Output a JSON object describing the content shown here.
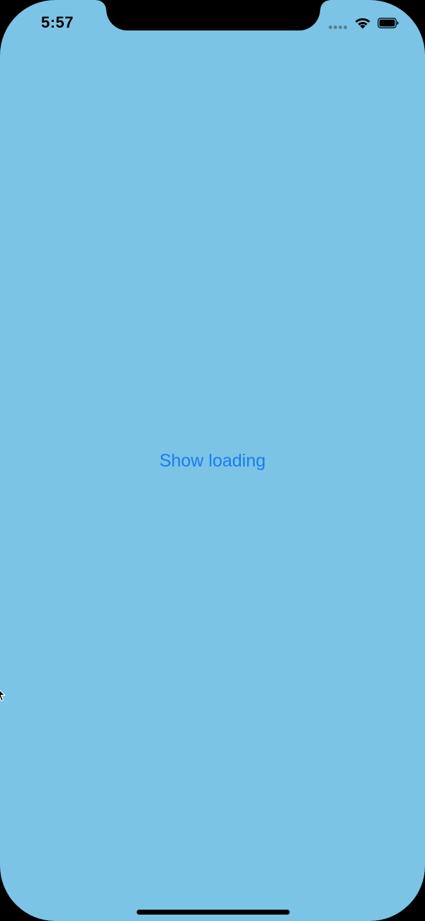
{
  "status_bar": {
    "time": "5:57",
    "signal_icon": "cellular-dots-icon",
    "wifi_icon": "wifi-icon",
    "battery_icon": "battery-icon"
  },
  "main": {
    "button_label": "Show loading",
    "background_color": "#7bc4e5",
    "button_color": "#1a7cf0"
  }
}
